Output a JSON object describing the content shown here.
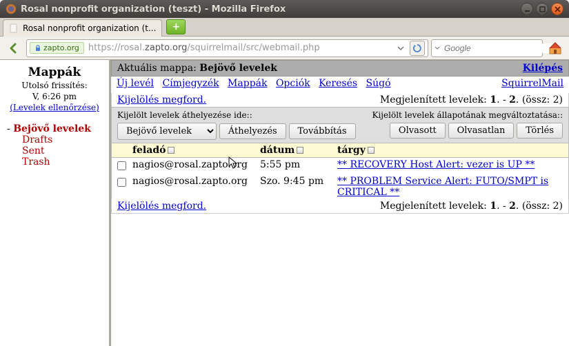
{
  "window": {
    "title": "Rosal nonprofit organization (teszt) - Mozilla Firefox"
  },
  "tab": {
    "title": "Rosal nonprofit organization (t..."
  },
  "urlbar": {
    "identity": "zapto.org",
    "proto": "https://rosal.",
    "host": "zapto.org",
    "path": "/squirrelmail/src/webmail.php"
  },
  "searchbar": {
    "placeholder": "Google"
  },
  "sidebar": {
    "heading": "Mappák",
    "lastRefreshLabel": "Utolsó frissítés:",
    "lastRefreshValue": "V, 6:26 pm",
    "checkMail": "(Levelek ellenőrzése)",
    "folders": {
      "inbox": "Bejövő levelek",
      "drafts": "Drafts",
      "sent": "Sent",
      "trash": "Trash"
    }
  },
  "header": {
    "currentFolderLabel": "Aktuális mappa:",
    "currentFolderValue": "Bejövő levelek",
    "logout": "Kilépés"
  },
  "menu": {
    "compose": "Új levél",
    "addresses": "Címjegyzék",
    "folders": "Mappák",
    "options": "Opciók",
    "search": "Keresés",
    "help": "Súgó",
    "brand": "SquirrelMail"
  },
  "list": {
    "toggleAll": "Kijelölés megford.",
    "viewingLabel": "Megjelenített levelek:",
    "viewingFrom": "1",
    "viewingTo": "2",
    "totalLabel": "(össz: 2)"
  },
  "actionbar": {
    "moveLabel": "Kijelölt levelek áthelyezése ide::",
    "moveTarget": "Bejövő levelek",
    "moveBtn": "Áthelyezés",
    "forwardBtn": "Továbbítás",
    "flagLabel": "Kijelölt levelek állapotának megváltoztatása::",
    "readBtn": "Olvasott",
    "unreadBtn": "Olvasatlan",
    "deleteBtn": "Törlés"
  },
  "columns": {
    "from": "feladó",
    "date": "dátum",
    "subject": "tárgy"
  },
  "messages": [
    {
      "from": "nagios@rosal.zapto.org",
      "date": "5:55 pm",
      "subject": "** RECOVERY Host Alert: vezer is UP **"
    },
    {
      "from": "nagios@rosal.zapto.org",
      "date": "Szo. 9:45 pm",
      "subject": "** PROBLEM Service Alert: FUTO/SMPT is CRITICAL **"
    }
  ]
}
